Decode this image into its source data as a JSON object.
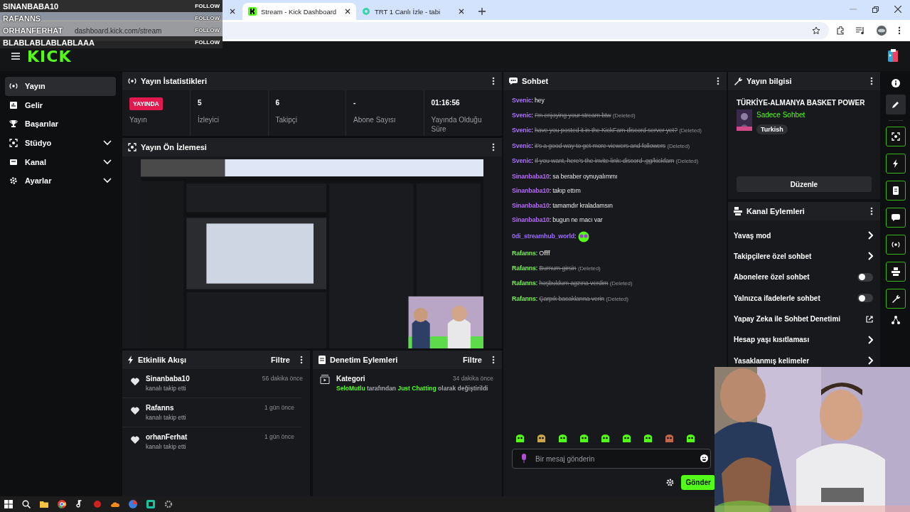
{
  "browser": {
    "tabs": [
      {
        "label": "Stream - Kick Dashboard",
        "selected": true
      },
      {
        "label": "TRT 1 Canlı İzle - tabi",
        "selected": false
      }
    ],
    "address": "dashboard.kick.com/stream"
  },
  "follow_alerts": [
    {
      "name": "SINANBABA10",
      "action": "FOLLOW",
      "faded": false
    },
    {
      "name": "RAFANNS",
      "action": "FOLLOW",
      "faded": true
    },
    {
      "name": "ORHANFERHAT",
      "action": "FOLLOW",
      "faded": true
    },
    {
      "name": "BLABLABLABLABLAAA",
      "action": "FOLLOW",
      "faded": false
    }
  ],
  "header": {
    "logo": "KICK"
  },
  "sidebar": {
    "items": [
      {
        "label": "Yayın",
        "selected": true,
        "expandable": false
      },
      {
        "label": "Gelir",
        "selected": false,
        "expandable": false
      },
      {
        "label": "Başarılar",
        "selected": false,
        "expandable": false
      },
      {
        "label": "Stüdyo",
        "selected": false,
        "expandable": true
      },
      {
        "label": "Kanal",
        "selected": false,
        "expandable": true
      },
      {
        "label": "Ayarlar",
        "selected": false,
        "expandable": true
      }
    ]
  },
  "stream_stats": {
    "title": "Yayın İstatistikleri",
    "status": {
      "badge": "YAYINDA",
      "label": "Yayın"
    },
    "stats": [
      {
        "value": "5",
        "label": "İzleyici"
      },
      {
        "value": "6",
        "label": "Takipçi"
      },
      {
        "value": "-",
        "label": "Abone Sayısı"
      },
      {
        "value": "01:16:56",
        "label": "Yayında Olduğu Süre"
      }
    ]
  },
  "stream_preview": {
    "title": "Yayın Ön İzlemesi",
    "kind": "picture"
  },
  "activity_feed": {
    "title": "Etkinlik Akışı",
    "filter": "Filtre",
    "items": [
      {
        "name": "Sinanbaba10",
        "action": "kanalı takip etti",
        "time": "56 dakika önce"
      },
      {
        "name": "Rafanns",
        "action": "kanalı takip etti",
        "time": "1 gün önce"
      },
      {
        "name": "orhanFerhat",
        "action": "kanalı takip etti",
        "time": "1 gün önce"
      }
    ]
  },
  "moderation": {
    "title": "Denetim Eylemleri",
    "filter": "Filtre",
    "items": [
      {
        "title": "Kategori",
        "time": "34 dakika önce",
        "parts": [
          {
            "text": "SeloMutlu",
            "highlight": true
          },
          {
            "text": " tarafından ",
            "highlight": false
          },
          {
            "text": "Just Chatting",
            "highlight": true
          },
          {
            "text": " olarak değiştirildi",
            "highlight": false
          }
        ]
      }
    ]
  },
  "chat": {
    "title": "Sohbet",
    "messages": [
      {
        "user": "Svenic",
        "sep": ":",
        "color": "#a970ff",
        "kind": "text",
        "text": "hey",
        "deleted": false
      },
      {
        "user": "Svenic",
        "sep": ":",
        "color": "#a970ff",
        "kind": "text",
        "text": "I'm enjoying your stream btw",
        "deleted": true,
        "note": "(Deleted)"
      },
      {
        "user": "Svenic",
        "sep": ":",
        "color": "#a970ff",
        "kind": "text",
        "text": "have you posted it in the KickFam discord server yet?",
        "deleted": true,
        "note": "(Deleted)"
      },
      {
        "user": "Svenic",
        "sep": ":",
        "color": "#a970ff",
        "kind": "text",
        "text": "it's a good way to get more viewers and followers",
        "deleted": true,
        "note": "(Deleted)"
      },
      {
        "user": "Svenic",
        "sep": ":",
        "color": "#a970ff",
        "kind": "text",
        "text": "If you want, here's the invite link: discord .gg/kickfam",
        "deleted": true,
        "note": "(Deleted)"
      },
      {
        "user": "Sinanbaba10",
        "sep": ":",
        "color": "#b36bf5",
        "kind": "text",
        "text": "sa beraber oynuyalımmı",
        "deleted": false
      },
      {
        "user": "Sinanbaba10",
        "sep": ":",
        "color": "#b36bf5",
        "kind": "text",
        "text": "takıp ettım",
        "deleted": false
      },
      {
        "user": "Sinanbaba10",
        "sep": ":",
        "color": "#b36bf5",
        "kind": "text",
        "text": "tamamdır kraladamsın",
        "deleted": false
      },
      {
        "user": "Sinanbaba10",
        "sep": ":",
        "color": "#b36bf5",
        "kind": "text",
        "text": "bugun ne macı var",
        "deleted": false
      },
      {
        "user": "0di_streamhub_world",
        "sep": ":",
        "color": "#9b6bff",
        "kind": "emote",
        "deleted": false
      },
      {
        "user": "Rafanns",
        "sep": ":",
        "color": "#75f04e",
        "kind": "text",
        "text": "Offff",
        "deleted": false
      },
      {
        "user": "Rafanns",
        "sep": ":",
        "color": "#75f04e",
        "kind": "text",
        "text": "Burnum girsin",
        "deleted": true,
        "note": "(Deleted)"
      },
      {
        "user": "Rafanns",
        "sep": ":",
        "color": "#75f04e",
        "kind": "text",
        "text": "hoşbuldum agzına verdim",
        "deleted": true,
        "note": "(Deleted)"
      },
      {
        "user": "Rafanns",
        "sep": ":",
        "color": "#75f04e",
        "kind": "text",
        "text": "Çarpık bacaklarına verin",
        "deleted": true,
        "note": "(Deleted)"
      }
    ],
    "input": {
      "placeholder": "Bir mesaj gönderin"
    },
    "send": "Gönder"
  },
  "stream_info": {
    "title": "Yayın bilgisi",
    "stream_title": "TÜRKİYE-ALMANYA BASKET POWER",
    "category": "Sadece Sohbet",
    "tags": [
      "Turkish"
    ],
    "edit": "Düzenle"
  },
  "channel_actions": {
    "title": "Kanal Eylemleri",
    "items": [
      {
        "label": "Yavaş mod",
        "kind": "link"
      },
      {
        "label": "Takipçilere özel sohbet",
        "kind": "link"
      },
      {
        "label": "Abonelere özel sohbet",
        "kind": "toggle",
        "on": false
      },
      {
        "label": "Yalnızca ifadelerle sohbet",
        "kind": "toggle",
        "on": false
      },
      {
        "label": "Yapay Zeka ile Sohbet Denetimi",
        "kind": "external"
      },
      {
        "label": "Hesap yaşı kısıtlaması",
        "kind": "link"
      },
      {
        "label": "Yasaklanmış kelimeler",
        "kind": "link"
      }
    ]
  }
}
